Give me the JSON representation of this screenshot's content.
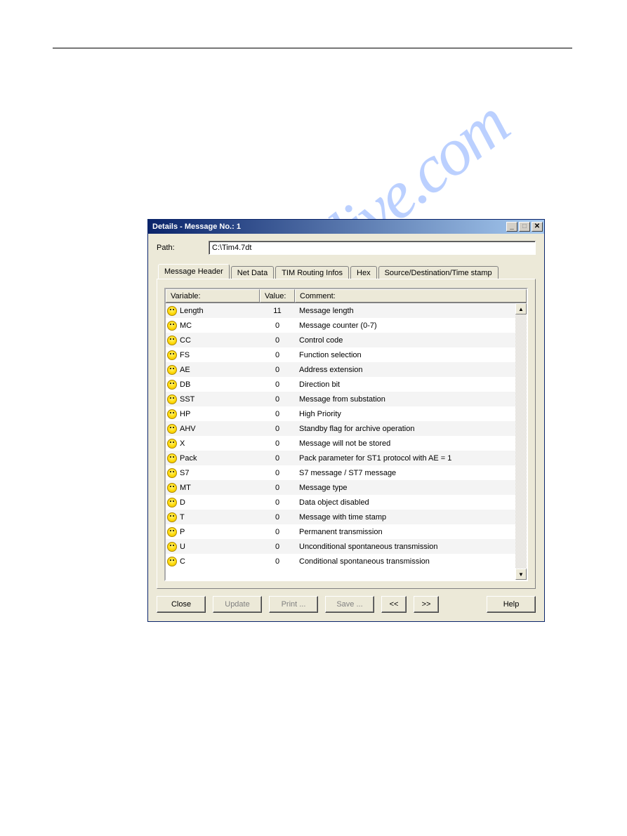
{
  "window": {
    "title": "Details - Message No.: 1"
  },
  "path": {
    "label": "Path:",
    "value": "C:\\Tim4.7dt"
  },
  "tabs": [
    {
      "label": "Message Header"
    },
    {
      "label": "Net Data"
    },
    {
      "label": "TIM Routing Infos"
    },
    {
      "label": "Hex"
    },
    {
      "label": "Source/Destination/Time stamp"
    }
  ],
  "columns": {
    "variable": "Variable:",
    "value": "Value:",
    "comment": "Comment:"
  },
  "rows": [
    {
      "var": "Length",
      "val": "11",
      "com": "Message length"
    },
    {
      "var": "MC",
      "val": "0",
      "com": "Message counter (0-7)"
    },
    {
      "var": "CC",
      "val": "0",
      "com": "Control code"
    },
    {
      "var": "FS",
      "val": "0",
      "com": "Function selection"
    },
    {
      "var": "AE",
      "val": "0",
      "com": "Address extension"
    },
    {
      "var": "DB",
      "val": "0",
      "com": "Direction bit"
    },
    {
      "var": "SST",
      "val": "0",
      "com": "Message from substation"
    },
    {
      "var": "HP",
      "val": "0",
      "com": "High Priority"
    },
    {
      "var": "AHV",
      "val": "0",
      "com": "Standby flag for archive operation"
    },
    {
      "var": "X",
      "val": "0",
      "com": "Message will not be stored"
    },
    {
      "var": "Pack",
      "val": "0",
      "com": "Pack parameter for ST1 protocol with  AE = 1"
    },
    {
      "var": "S7",
      "val": "0",
      "com": "S7 message / ST7 message"
    },
    {
      "var": "MT",
      "val": "0",
      "com": "Message type"
    },
    {
      "var": "D",
      "val": "0",
      "com": "Data object disabled"
    },
    {
      "var": "T",
      "val": "0",
      "com": "Message with time stamp"
    },
    {
      "var": "P",
      "val": "0",
      "com": "Permanent transmission"
    },
    {
      "var": "U",
      "val": "0",
      "com": "Unconditional spontaneous transmission"
    },
    {
      "var": "C",
      "val": "0",
      "com": "Conditional spontaneous transmission"
    }
  ],
  "buttons": {
    "close": "Close",
    "update": "Update",
    "print": "Print ...",
    "save": "Save ...",
    "prev": "<<",
    "next": ">>",
    "help": "Help"
  },
  "watermark": "manualslive.com"
}
